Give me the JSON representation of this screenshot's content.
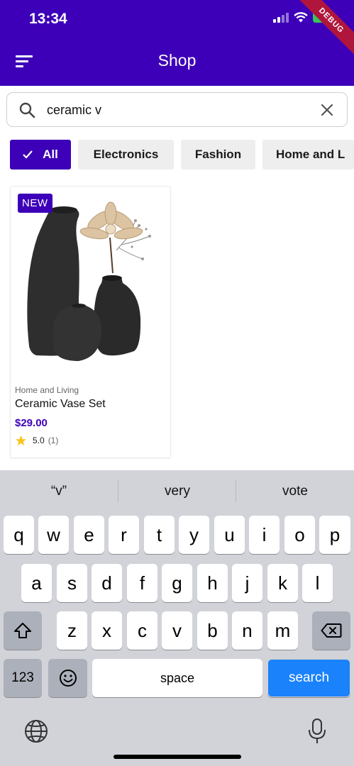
{
  "status_bar": {
    "time": "13:34",
    "battery": "95",
    "debug_banner": "DEBUG"
  },
  "app_bar": {
    "title": "Shop"
  },
  "search": {
    "value": "ceramic v"
  },
  "filters": [
    {
      "label": "All",
      "selected": true
    },
    {
      "label": "Electronics",
      "selected": false
    },
    {
      "label": "Fashion",
      "selected": false
    },
    {
      "label": "Home and L",
      "selected": false
    }
  ],
  "products": [
    {
      "badge": "NEW",
      "category": "Home and Living",
      "name": "Ceramic Vase Set",
      "price": "$29.00",
      "rating": "5.0",
      "rating_count": "(1)"
    }
  ],
  "keyboard": {
    "suggestions": [
      "“v”",
      "very",
      "vote"
    ],
    "row1": [
      "q",
      "w",
      "e",
      "r",
      "t",
      "y",
      "u",
      "i",
      "o",
      "p"
    ],
    "row2": [
      "a",
      "s",
      "d",
      "f",
      "g",
      "h",
      "j",
      "k",
      "l"
    ],
    "row3": [
      "z",
      "x",
      "c",
      "v",
      "b",
      "n",
      "m"
    ],
    "numbers_label": "123",
    "space_label": "space",
    "action_label": "search"
  },
  "colors": {
    "primary": "#3d00b8",
    "keyboard_action": "#1a82fb",
    "battery": "#34c759",
    "debug": "#b0163c"
  },
  "icons": [
    "sort-menu-icon",
    "search-icon",
    "clear-icon",
    "check-icon",
    "star-icon",
    "shift-icon",
    "backspace-icon",
    "emoji-icon",
    "globe-icon",
    "microphone-icon",
    "signal-icon",
    "wifi-icon",
    "battery-icon"
  ]
}
